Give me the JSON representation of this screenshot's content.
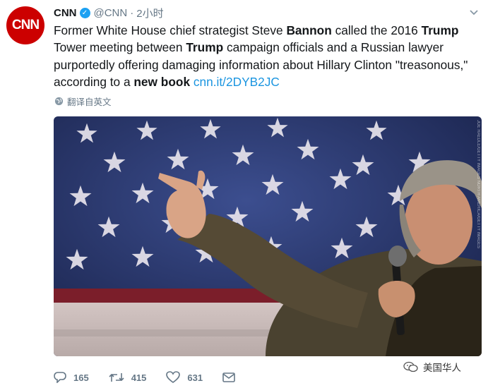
{
  "author": {
    "avatar_text": "CNN",
    "name": "CNN",
    "handle": "@CNN",
    "separator": "·",
    "time": "2小时",
    "brand_color": "#cc0000"
  },
  "tweet": {
    "t1": "Former White House chief strategist Steve ",
    "b1": "Bannon",
    "t2": " called the 2016 ",
    "b2": "Trump",
    "t3": " Tower meeting between ",
    "b3": "Trump",
    "t4": " campaign officials and a Russian lawyer purportedly offering damaging information about Hillary Clinton \"treasonous,\" according to a ",
    "b4": "new book",
    "t5": " ",
    "link": "cnn.it/2DYB2JC",
    "link_color": "#1b95e0"
  },
  "translate_label": "翻译自英文",
  "media": {
    "credit": "JOE RAEDLE/GETTY IMAGES NORTH AMERICA/GETTY IMAGES"
  },
  "actions": {
    "reply_count": "165",
    "retweet_count": "415",
    "like_count": "631"
  },
  "watermark": "美国华人",
  "icons": [
    "verified-icon",
    "chevron-down-icon",
    "globe-icon",
    "reply-icon",
    "retweet-icon",
    "like-icon",
    "dm-icon",
    "wechat-icon"
  ]
}
